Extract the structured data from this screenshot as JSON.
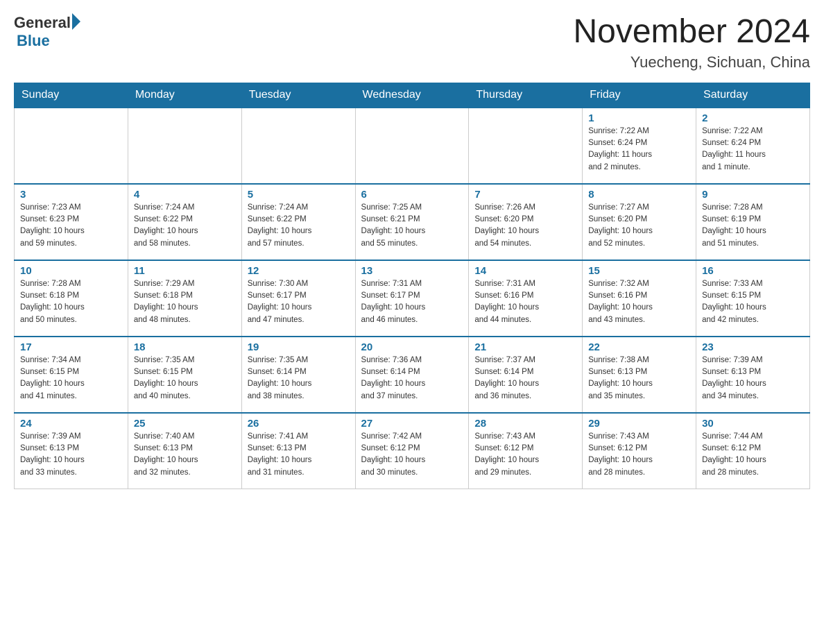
{
  "header": {
    "logo_general": "General",
    "logo_blue": "Blue",
    "month_title": "November 2024",
    "location": "Yuecheng, Sichuan, China"
  },
  "days_of_week": [
    "Sunday",
    "Monday",
    "Tuesday",
    "Wednesday",
    "Thursday",
    "Friday",
    "Saturday"
  ],
  "weeks": [
    [
      {
        "day": "",
        "info": ""
      },
      {
        "day": "",
        "info": ""
      },
      {
        "day": "",
        "info": ""
      },
      {
        "day": "",
        "info": ""
      },
      {
        "day": "",
        "info": ""
      },
      {
        "day": "1",
        "info": "Sunrise: 7:22 AM\nSunset: 6:24 PM\nDaylight: 11 hours\nand 2 minutes."
      },
      {
        "day": "2",
        "info": "Sunrise: 7:22 AM\nSunset: 6:24 PM\nDaylight: 11 hours\nand 1 minute."
      }
    ],
    [
      {
        "day": "3",
        "info": "Sunrise: 7:23 AM\nSunset: 6:23 PM\nDaylight: 10 hours\nand 59 minutes."
      },
      {
        "day": "4",
        "info": "Sunrise: 7:24 AM\nSunset: 6:22 PM\nDaylight: 10 hours\nand 58 minutes."
      },
      {
        "day": "5",
        "info": "Sunrise: 7:24 AM\nSunset: 6:22 PM\nDaylight: 10 hours\nand 57 minutes."
      },
      {
        "day": "6",
        "info": "Sunrise: 7:25 AM\nSunset: 6:21 PM\nDaylight: 10 hours\nand 55 minutes."
      },
      {
        "day": "7",
        "info": "Sunrise: 7:26 AM\nSunset: 6:20 PM\nDaylight: 10 hours\nand 54 minutes."
      },
      {
        "day": "8",
        "info": "Sunrise: 7:27 AM\nSunset: 6:20 PM\nDaylight: 10 hours\nand 52 minutes."
      },
      {
        "day": "9",
        "info": "Sunrise: 7:28 AM\nSunset: 6:19 PM\nDaylight: 10 hours\nand 51 minutes."
      }
    ],
    [
      {
        "day": "10",
        "info": "Sunrise: 7:28 AM\nSunset: 6:18 PM\nDaylight: 10 hours\nand 50 minutes."
      },
      {
        "day": "11",
        "info": "Sunrise: 7:29 AM\nSunset: 6:18 PM\nDaylight: 10 hours\nand 48 minutes."
      },
      {
        "day": "12",
        "info": "Sunrise: 7:30 AM\nSunset: 6:17 PM\nDaylight: 10 hours\nand 47 minutes."
      },
      {
        "day": "13",
        "info": "Sunrise: 7:31 AM\nSunset: 6:17 PM\nDaylight: 10 hours\nand 46 minutes."
      },
      {
        "day": "14",
        "info": "Sunrise: 7:31 AM\nSunset: 6:16 PM\nDaylight: 10 hours\nand 44 minutes."
      },
      {
        "day": "15",
        "info": "Sunrise: 7:32 AM\nSunset: 6:16 PM\nDaylight: 10 hours\nand 43 minutes."
      },
      {
        "day": "16",
        "info": "Sunrise: 7:33 AM\nSunset: 6:15 PM\nDaylight: 10 hours\nand 42 minutes."
      }
    ],
    [
      {
        "day": "17",
        "info": "Sunrise: 7:34 AM\nSunset: 6:15 PM\nDaylight: 10 hours\nand 41 minutes."
      },
      {
        "day": "18",
        "info": "Sunrise: 7:35 AM\nSunset: 6:15 PM\nDaylight: 10 hours\nand 40 minutes."
      },
      {
        "day": "19",
        "info": "Sunrise: 7:35 AM\nSunset: 6:14 PM\nDaylight: 10 hours\nand 38 minutes."
      },
      {
        "day": "20",
        "info": "Sunrise: 7:36 AM\nSunset: 6:14 PM\nDaylight: 10 hours\nand 37 minutes."
      },
      {
        "day": "21",
        "info": "Sunrise: 7:37 AM\nSunset: 6:14 PM\nDaylight: 10 hours\nand 36 minutes."
      },
      {
        "day": "22",
        "info": "Sunrise: 7:38 AM\nSunset: 6:13 PM\nDaylight: 10 hours\nand 35 minutes."
      },
      {
        "day": "23",
        "info": "Sunrise: 7:39 AM\nSunset: 6:13 PM\nDaylight: 10 hours\nand 34 minutes."
      }
    ],
    [
      {
        "day": "24",
        "info": "Sunrise: 7:39 AM\nSunset: 6:13 PM\nDaylight: 10 hours\nand 33 minutes."
      },
      {
        "day": "25",
        "info": "Sunrise: 7:40 AM\nSunset: 6:13 PM\nDaylight: 10 hours\nand 32 minutes."
      },
      {
        "day": "26",
        "info": "Sunrise: 7:41 AM\nSunset: 6:13 PM\nDaylight: 10 hours\nand 31 minutes."
      },
      {
        "day": "27",
        "info": "Sunrise: 7:42 AM\nSunset: 6:12 PM\nDaylight: 10 hours\nand 30 minutes."
      },
      {
        "day": "28",
        "info": "Sunrise: 7:43 AM\nSunset: 6:12 PM\nDaylight: 10 hours\nand 29 minutes."
      },
      {
        "day": "29",
        "info": "Sunrise: 7:43 AM\nSunset: 6:12 PM\nDaylight: 10 hours\nand 28 minutes."
      },
      {
        "day": "30",
        "info": "Sunrise: 7:44 AM\nSunset: 6:12 PM\nDaylight: 10 hours\nand 28 minutes."
      }
    ]
  ]
}
